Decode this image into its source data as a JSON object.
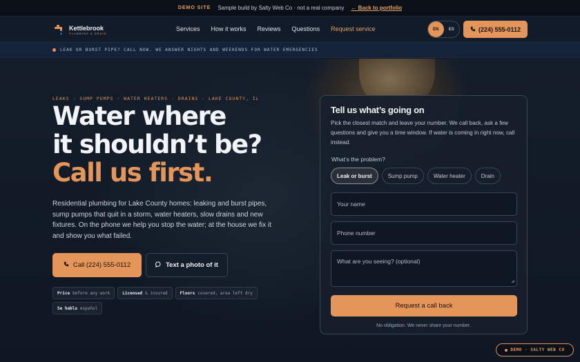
{
  "demo_bar": {
    "tag": "DEMO SITE",
    "text": "Sample build by Salty Web Co · not a real company",
    "link": "← Back to portfolio"
  },
  "header": {
    "logo_name": "Kettlebrook",
    "logo_sub": "PLUMBING & DRAIN",
    "nav": [
      "Services",
      "How it works",
      "Reviews",
      "Questions",
      "Request service"
    ],
    "lang": [
      "EN",
      "ES"
    ],
    "phone": "(224) 555-0112",
    "accent": "#e3955a"
  },
  "alert": {
    "text": "LEAK OR BURST PIPE? CALL NOW. WE ANSWER NIGHTS AND WEEKENDS FOR WATER EMERGENCIES"
  },
  "hero": {
    "eyebrow": "LEAKS · SUMP PUMPS · WATER HEATERS · DRAINS · LAKE COUNTY, IL",
    "headline_1": "Water where",
    "headline_2": "it shouldn’t be?",
    "headline_3": "Call us first.",
    "lead": "Residential plumbing for Lake County homes: leaking and burst pipes, sump pumps that quit in a storm, water heaters, slow drains and new fixtures. On the phone we help you stop the water; at the house we fix it and show you what failed.",
    "call_button": "Call (224) 555-0112",
    "text_button": "Text a photo of it",
    "chips": [
      {
        "bold": "Price",
        "rest": "before any work"
      },
      {
        "bold": "Licensed",
        "rest": "& insured"
      },
      {
        "bold": "Floors",
        "rest": "covered, area left dry"
      },
      {
        "bold": "Se habla",
        "rest": "español"
      }
    ]
  },
  "form": {
    "title": "Tell us what’s going on",
    "description": "Pick the closest match and leave your number. We call back, ask a few questions and give you a time window. If water is coming in right now, call instead.",
    "question": "What’s the problem?",
    "options": [
      "Leak or burst",
      "Sump pump",
      "Water heater",
      "Drain"
    ],
    "selected": "Leak or burst",
    "name_placeholder": "Your name",
    "phone_placeholder": "Phone number",
    "details_placeholder": "What are you seeing? (optional)",
    "submit": "Request a call back",
    "note": "No obligation. We never share your number."
  },
  "badge": {
    "text": "DEMO · SALTY WEB CO"
  }
}
